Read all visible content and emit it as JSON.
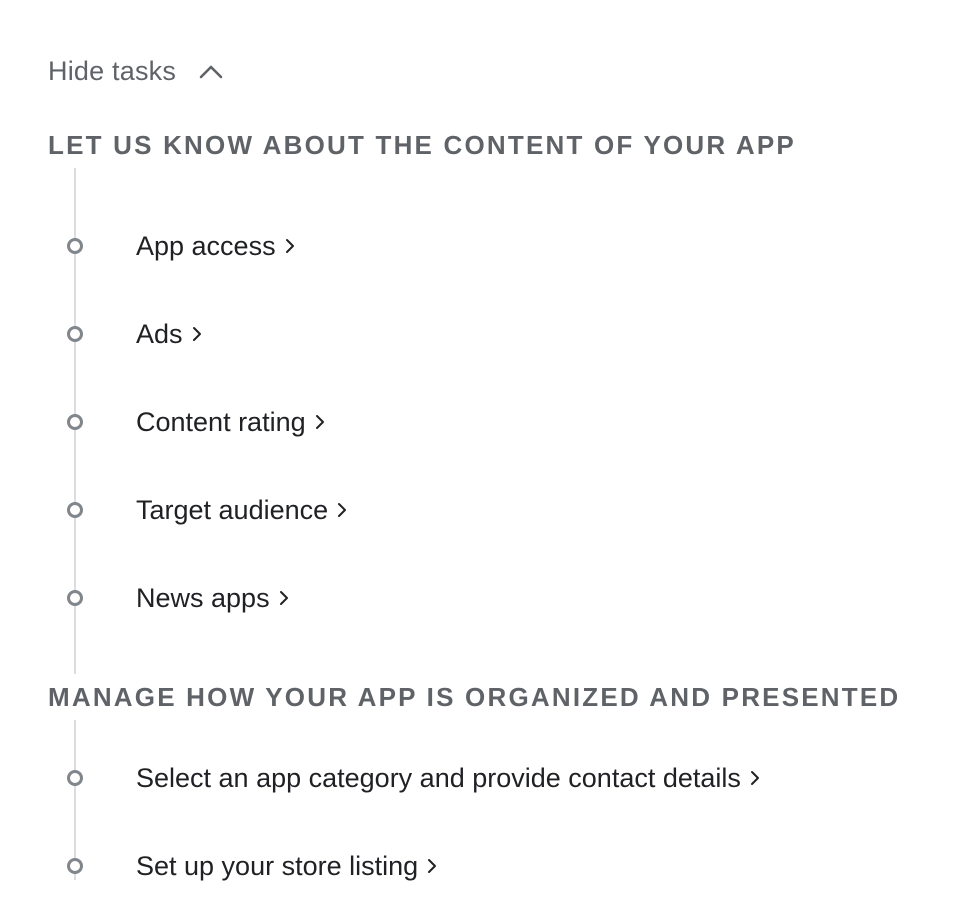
{
  "toggle": {
    "label": "Hide tasks",
    "icon": "chevron-up-icon"
  },
  "sections": [
    {
      "title": "LET US KNOW ABOUT THE CONTENT OF YOUR APP",
      "tasks": [
        {
          "label": "App access"
        },
        {
          "label": "Ads"
        },
        {
          "label": "Content rating"
        },
        {
          "label": "Target audience"
        },
        {
          "label": "News apps"
        }
      ]
    },
    {
      "title": "MANAGE HOW YOUR APP IS ORGANIZED AND PRESENTED",
      "tasks": [
        {
          "label": "Select an app category and provide contact details"
        },
        {
          "label": "Set up your store listing"
        }
      ]
    }
  ],
  "colors": {
    "muted_text": "#5f6368",
    "task_text": "#202124",
    "timeline": "#dadce0",
    "dot": "#80868b"
  }
}
